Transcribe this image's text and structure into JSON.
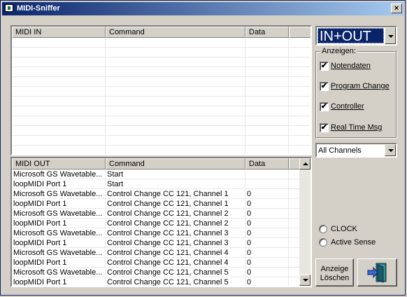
{
  "window": {
    "title": "MIDI-Sniffer",
    "close_glyph": "×"
  },
  "midi_in": {
    "columns": [
      "MIDI IN",
      "Command",
      "Data"
    ],
    "rows": []
  },
  "midi_out": {
    "columns": [
      "MIDI OUT",
      "Command",
      "Data"
    ],
    "rows": [
      [
        "Microsoft GS Wavetable...",
        "Start",
        ""
      ],
      [
        "loopMIDI Port 1",
        "Start",
        ""
      ],
      [
        "Microsoft GS Wavetable...",
        "Control Change CC 121, Channel 1",
        "0"
      ],
      [
        "loopMIDI Port 1",
        "Control Change CC 121, Channel 1",
        "0"
      ],
      [
        "Microsoft GS Wavetable...",
        "Control Change CC 121, Channel 2",
        "0"
      ],
      [
        "loopMIDI Port 1",
        "Control Change CC 121, Channel 2",
        "0"
      ],
      [
        "Microsoft GS Wavetable...",
        "Control Change CC 121, Channel 3",
        "0"
      ],
      [
        "loopMIDI Port 1",
        "Control Change CC 121, Channel 3",
        "0"
      ],
      [
        "Microsoft GS Wavetable...",
        "Control Change CC 121, Channel 4",
        "0"
      ],
      [
        "loopMIDI Port 1",
        "Control Change CC 121, Channel 4",
        "0"
      ],
      [
        "Microsoft GS Wavetable...",
        "Control Change CC 121, Channel 5",
        "0"
      ],
      [
        "loopMIDI Port 1",
        "Control Change CC 121, Channel 5",
        "0"
      ]
    ]
  },
  "mode_select": {
    "value": "IN+OUT"
  },
  "display_group": {
    "legend": "Anzeigen:",
    "options": [
      {
        "label": "Notendaten",
        "checked": true
      },
      {
        "label": "Program Change",
        "checked": true
      },
      {
        "label": "Controller",
        "checked": true
      },
      {
        "label": "Real Time Msg",
        "checked": true
      }
    ],
    "check_glyph": "✔"
  },
  "channel_select": {
    "value": "All Channels"
  },
  "radios": [
    {
      "label": "CLOCK",
      "selected": false
    },
    {
      "label": "Active Sense",
      "selected": false
    }
  ],
  "clear_button": {
    "line1": "Anzeige",
    "line2": "Löschen"
  },
  "exit_button": {
    "icon": "exit-door-icon"
  },
  "colors": {
    "titlebar_start": "#0a246a",
    "titlebar_end": "#a6caf0",
    "face": "#d4d0c8"
  }
}
